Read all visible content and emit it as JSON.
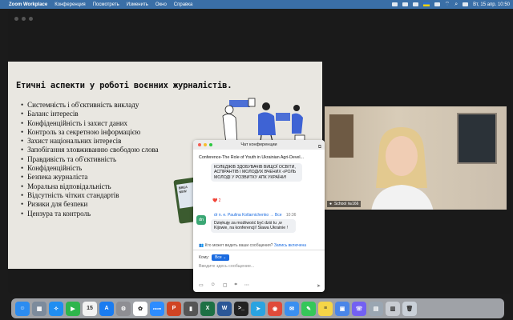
{
  "menubar": {
    "app_name": "Zoom Workplace",
    "items": [
      "Конференция",
      "Посмотреть",
      "Изменить",
      "Окно",
      "Справка"
    ],
    "clock": "Вт, 15 апр. 10:50"
  },
  "slide": {
    "title": "Етичні аспекти у роботі воєнних журналістів.",
    "bullets": [
      "Системність і об'єктивність викладу",
      "Баланс інтересів",
      "Конфіденційність і захист даних",
      "Контроль за секретною інформацією",
      "Захист національних інтересів",
      "Запобігання зловживанню свободою слова",
      "Правдивість та об'єктивність",
      "Конфіденційність",
      "Безпека журналіста",
      "Моральна відповідальність",
      "Відсутність чітких стандартів",
      "Ризики для безпеки",
      "Цензура та контроль"
    ],
    "phone_text": "BREA NEW"
  },
  "video": {
    "participant_name": "School №166"
  },
  "chat": {
    "title": "Чат конференции",
    "conference_name": "Conference-The Role of Youth in Ukrainian Agri-Devel...",
    "message1": "КОЛЕДЖІВ ЗДОБУВАЧІВ ВИЩОЇ ОСВІТИ, АСПІРАНТІВ І МОЛОДИХ ВЧЕНИХ «РОЛЬ МОЛОДІ У РОЗВИТКУ АПК УКРАЇНИ!",
    "reaction": "❤️ 2",
    "avatar_initials": "dn",
    "sender": "dr n. e. Paulina Kotlarnichenko → Все",
    "time": "10:36",
    "message2": "Dziękuję za możliwość być dziś tu ,w Kijowie, na konferencji! Slawa Ukrainie !",
    "notice": "Кто может видеть ваши сообщения?",
    "notice_link": "Запись включена",
    "to_label": "Кому:",
    "to_value": "Все",
    "input_placeholder": "Введите здесь сообщение..."
  },
  "dock": {
    "apps": [
      {
        "name": "finder",
        "color": "#2c8cf0",
        "glyph": "☺"
      },
      {
        "name": "launchpad",
        "color": "#7c8b9c",
        "glyph": "▦"
      },
      {
        "name": "safari",
        "color": "#1f8ef1",
        "glyph": "✧"
      },
      {
        "name": "facetime",
        "color": "#2eb54c",
        "glyph": "▶"
      },
      {
        "name": "calendar",
        "color": "#f2f2f2",
        "glyph": "15"
      },
      {
        "name": "app-store",
        "color": "#1a7cf0",
        "glyph": "A"
      },
      {
        "name": "settings",
        "color": "#8e8e93",
        "glyph": "⚙"
      },
      {
        "name": "photos",
        "color": "#ffffff",
        "glyph": "✿"
      },
      {
        "name": "zoom",
        "color": "#2d8cff",
        "glyph": "zoom"
      },
      {
        "name": "powerpoint",
        "color": "#d04423",
        "glyph": "P"
      },
      {
        "name": "launcher",
        "color": "#555555",
        "glyph": "▮"
      },
      {
        "name": "excel",
        "color": "#1d7044",
        "glyph": "X"
      },
      {
        "name": "word",
        "color": "#2b5797",
        "glyph": "W"
      },
      {
        "name": "terminal",
        "color": "#222222",
        "glyph": ">_"
      },
      {
        "name": "telegram",
        "color": "#2aa3e0",
        "glyph": "➤"
      },
      {
        "name": "chrome",
        "color": "#e04a3a",
        "glyph": "◉"
      },
      {
        "name": "mail",
        "color": "#3a8ff0",
        "glyph": "✉"
      },
      {
        "name": "messages",
        "color": "#35c759",
        "glyph": "✎"
      },
      {
        "name": "notes",
        "color": "#f5d547",
        "glyph": "≡"
      },
      {
        "name": "app-blue",
        "color": "#4a86e8",
        "glyph": "▣"
      },
      {
        "name": "viber",
        "color": "#7360f2",
        "glyph": "☏"
      },
      {
        "name": "preview",
        "color": "#9aa6b2",
        "glyph": "▤"
      },
      {
        "name": "downloads",
        "color": "#c8ccd2",
        "glyph": "▥"
      },
      {
        "name": "trash",
        "color": "#c9d0d8",
        "glyph": "🗑"
      }
    ]
  }
}
